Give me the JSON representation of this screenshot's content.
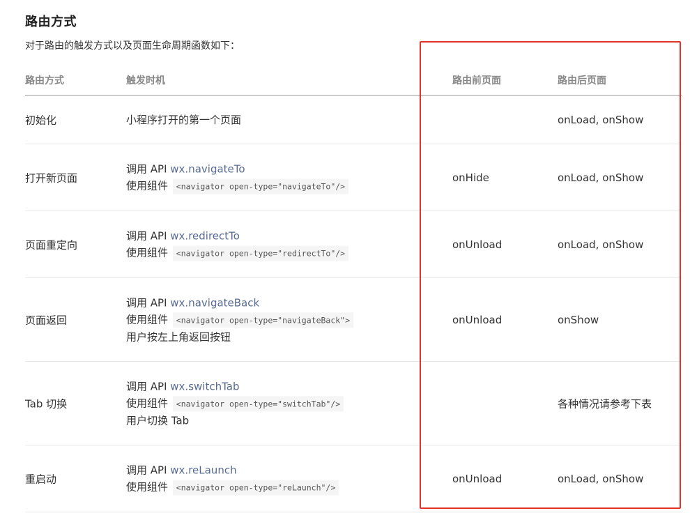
{
  "title": "路由方式",
  "intro": "对于路由的触发方式以及页面生命周期函数如下：",
  "table": {
    "headers": [
      "路由方式",
      "触发时机",
      "路由前页面",
      "路由后页面"
    ],
    "rows": [
      {
        "mode": "初始化",
        "trigger_lines": [
          {
            "text": "小程序打开的第一个页面"
          }
        ],
        "before": "",
        "after": "onLoad, onShow"
      },
      {
        "mode": "打开新页面",
        "trigger_lines": [
          {
            "prefix": "调用 API ",
            "link": "wx.navigateTo"
          },
          {
            "prefix": "使用组件 ",
            "code": "<navigator open-type=\"navigateTo\"/>"
          }
        ],
        "before": "onHide",
        "after": "onLoad, onShow"
      },
      {
        "mode": "页面重定向",
        "trigger_lines": [
          {
            "prefix": "调用 API ",
            "link": "wx.redirectTo"
          },
          {
            "prefix": "使用组件 ",
            "code": "<navigator open-type=\"redirectTo\"/>"
          }
        ],
        "before": "onUnload",
        "after": "onLoad, onShow"
      },
      {
        "mode": "页面返回",
        "trigger_lines": [
          {
            "prefix": "调用 API ",
            "link": "wx.navigateBack"
          },
          {
            "prefix": "使用组件 ",
            "code": "<navigator open-type=\"navigateBack\">"
          },
          {
            "text": "用户按左上角返回按钮"
          }
        ],
        "before": "onUnload",
        "after": "onShow"
      },
      {
        "mode": "Tab 切换",
        "trigger_lines": [
          {
            "prefix": "调用 API ",
            "link": "wx.switchTab"
          },
          {
            "prefix": "使用组件 ",
            "code": "<navigator open-type=\"switchTab\"/>"
          },
          {
            "text": "用户切换 Tab"
          }
        ],
        "before": "",
        "after": "各种情况请参考下表"
      },
      {
        "mode": "重启动",
        "trigger_lines": [
          {
            "prefix": "调用 API ",
            "link": "wx.reLaunch"
          },
          {
            "prefix": "使用组件 ",
            "code": "<navigator open-type=\"reLaunch\"/>"
          }
        ],
        "before": "onUnload",
        "after": "onLoad, onShow"
      }
    ]
  },
  "colors": {
    "link": "#576b95",
    "highlight_border": "#e1322a",
    "header_text": "#888888",
    "code_bg": "#f5f5f5"
  }
}
